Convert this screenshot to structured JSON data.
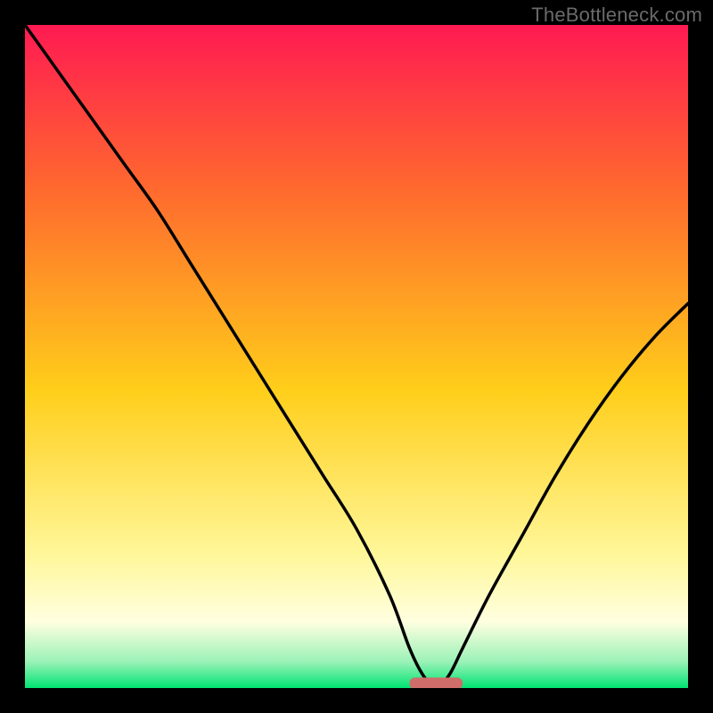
{
  "watermark": "TheBottleneck.com",
  "colors": {
    "black": "#000000",
    "gradient_top": "#ff1a52",
    "gradient_mid_upper": "#ff6a2e",
    "gradient_mid": "#ffce1a",
    "gradient_lower": "#fff79a",
    "gradient_pale": "#ffffe0",
    "gradient_green_light": "#9cf2b8",
    "gradient_green": "#00e472",
    "curve": "#000000",
    "marker": "#cf6d6a"
  },
  "chart_data": {
    "type": "line",
    "title": "",
    "xlabel": "",
    "ylabel": "",
    "xlim": [
      0,
      100
    ],
    "ylim": [
      0,
      100
    ],
    "optimum_x": 62,
    "marker": {
      "x_start": 58,
      "x_end": 66,
      "y": 0.7
    },
    "series": [
      {
        "name": "bottleneck-curve",
        "x": [
          0,
          5,
          10,
          15,
          20,
          25,
          30,
          35,
          40,
          45,
          50,
          55,
          58,
          60,
          62,
          64,
          66,
          70,
          75,
          80,
          85,
          90,
          95,
          100
        ],
        "y": [
          100,
          93,
          86,
          79,
          72,
          64,
          56,
          48,
          40,
          32,
          24,
          14,
          6,
          2,
          0,
          2,
          6,
          14,
          23,
          32,
          40,
          47,
          53,
          58
        ]
      }
    ],
    "annotations": []
  }
}
